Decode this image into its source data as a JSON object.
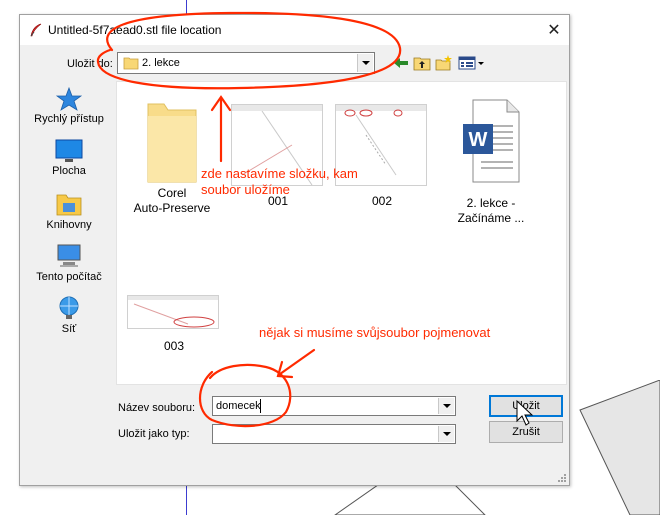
{
  "dialog": {
    "title": "Untitled-5f7aead0.stl file location",
    "close_glyph": "✕",
    "save_in_label": "Uložit do:",
    "save_in_value": "2. lekce",
    "toolbar_icons": [
      "back-icon",
      "up-folder-icon",
      "new-folder-icon",
      "view-menu-icon"
    ]
  },
  "places": [
    {
      "label": "Rychlý přístup",
      "icon": "star-icon"
    },
    {
      "label": "Plocha",
      "icon": "desktop-icon"
    },
    {
      "label": "Knihovny",
      "icon": "libraries-icon"
    },
    {
      "label": "Tento počítač",
      "icon": "computer-icon"
    },
    {
      "label": "Síť",
      "icon": "network-icon"
    }
  ],
  "files": [
    {
      "name_line1": "Corel",
      "name_line2": "Auto-Preserve",
      "type": "folder"
    },
    {
      "name_line1": "001",
      "name_line2": "",
      "type": "image"
    },
    {
      "name_line1": "002",
      "name_line2": "",
      "type": "image"
    },
    {
      "name_line1": "2. lekce -",
      "name_line2": "Začínáme ...",
      "type": "word-document"
    },
    {
      "name_line1": "003",
      "name_line2": "",
      "type": "image"
    }
  ],
  "form": {
    "filename_label": "Název souboru:",
    "filename_value": "domecek",
    "filetype_label": "Uložit jako typ:",
    "filetype_value": ""
  },
  "buttons": {
    "save": "Uložit",
    "cancel": "Zrušit"
  },
  "annotations": {
    "folder_note_line1": "zde nastavíme složku, kam",
    "folder_note_line2": "soubor uložíme",
    "name_note": "nějak si musíme svůjsoubor pojmenovat",
    "color": "#ff2a00"
  }
}
